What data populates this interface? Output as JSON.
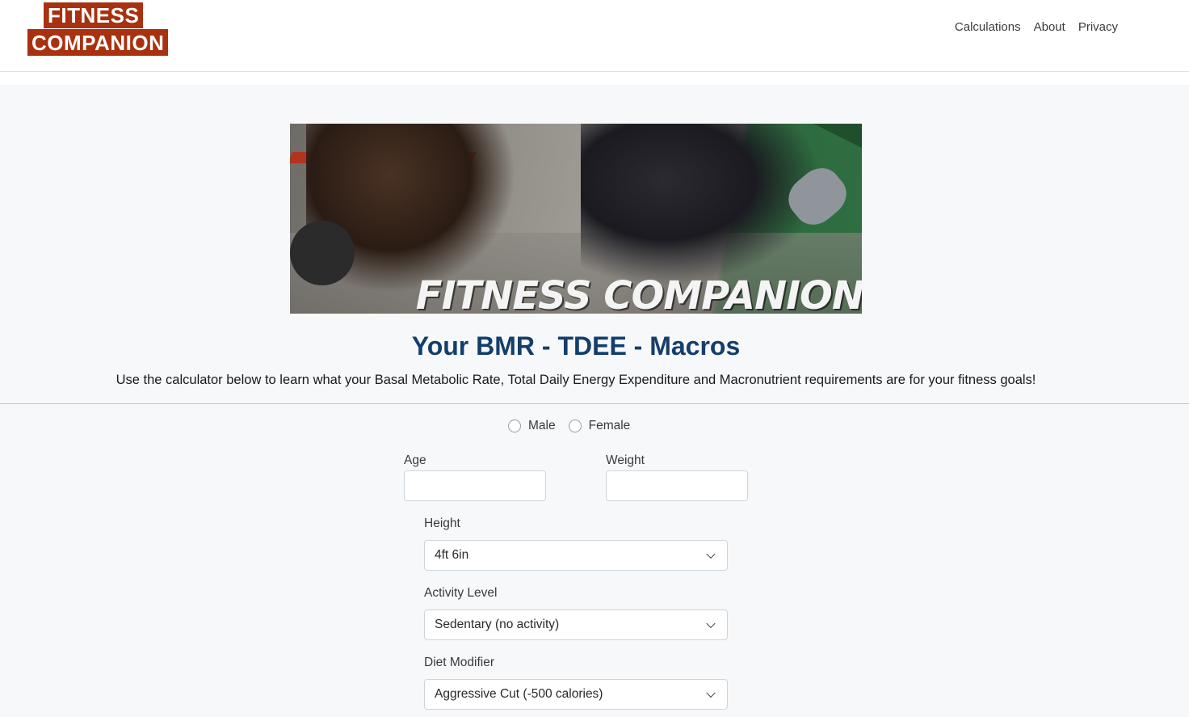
{
  "brand": {
    "line1": "FITNESS",
    "line2": "COMPANION"
  },
  "nav": {
    "items": [
      "Calculations",
      "About",
      "Privacy"
    ]
  },
  "banner": {
    "text": "FITNESS COMPANION"
  },
  "page": {
    "title": "Your BMR - TDEE - Macros",
    "subtitle": "Use the calculator below to learn what your Basal Metabolic Rate, Total Daily Energy Expenditure and Macronutrient requirements are for your fitness goals!"
  },
  "form": {
    "gender_options": [
      "Male",
      "Female"
    ],
    "age_label": "Age",
    "age_value": "",
    "weight_label": "Weight",
    "weight_value": "",
    "height_label": "Height",
    "height_value": "4ft 6in",
    "activity_label": "Activity Level",
    "activity_value": "Sedentary (no activity)",
    "diet_label": "Diet Modifier",
    "diet_value": "Aggressive Cut (-500 calories)"
  },
  "colors": {
    "brand": "#a8310f",
    "title": "#143e6b",
    "background": "#f7f8fa"
  }
}
